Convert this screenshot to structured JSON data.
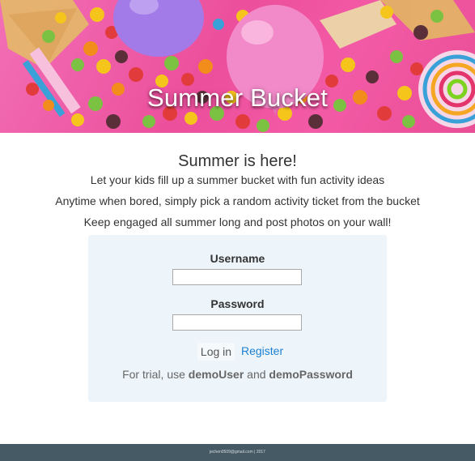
{
  "banner": {
    "title": "Summer Bucket",
    "colors": {
      "background": "#ec4f9c",
      "balloon_purple": "#a37be8",
      "balloon_pink": "#f28ac9"
    }
  },
  "intro": {
    "heading": "Summer is here!",
    "line1": "Let your kids fill up a summer bucket with fun activity ideas",
    "line2": "Anytime when bored, simply pick a random activity ticket from the bucket",
    "line3": "Keep engaged all summer long and post photos on your wall!"
  },
  "login": {
    "username_label": "Username",
    "username_value": "",
    "password_label": "Password",
    "password_value": "",
    "login_button": "Log in",
    "register_link": "Register",
    "trial_prefix": "For trial, use",
    "trial_user": "demoUser",
    "trial_and": "and",
    "trial_password": "demoPassword",
    "colors": {
      "card_background": "#edf5fb",
      "link": "#1b7fd1"
    }
  },
  "footer": {
    "text": "jechen0509@gmail.com | 2017",
    "colors": {
      "background": "#455a64"
    }
  }
}
